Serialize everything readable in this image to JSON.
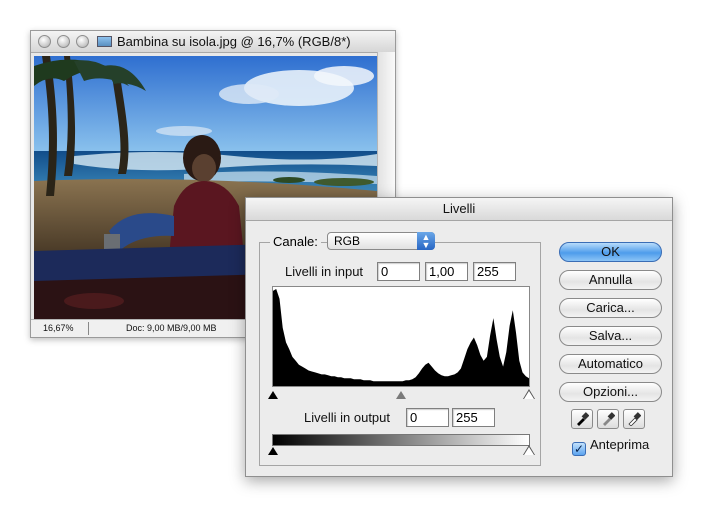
{
  "document_window": {
    "title": "Bambina su isola.jpg @ 16,7% (RGB/8*)",
    "zoom": "16,67%",
    "doc_info": "Doc: 9,00 MB/9,00 MB"
  },
  "levels_dialog": {
    "title": "Livelli",
    "channel_label": "Canale:",
    "channel_value": "RGB",
    "input_levels_label": "Livelli in input",
    "input_black": "0",
    "input_gamma": "1,00",
    "input_white": "255",
    "output_levels_label": "Livelli in output",
    "output_black": "0",
    "output_white": "255",
    "buttons": {
      "ok": "OK",
      "cancel": "Annulla",
      "load": "Carica...",
      "save": "Salva...",
      "auto": "Automatico",
      "options": "Opzioni..."
    },
    "preview_label": "Anteprima",
    "preview_checked": true,
    "histogram": [
      98,
      100,
      90,
      60,
      45,
      38,
      30,
      26,
      22,
      20,
      18,
      16,
      15,
      14,
      13,
      12,
      12,
      11,
      10,
      10,
      9,
      9,
      8,
      8,
      8,
      7,
      7,
      7,
      6,
      6,
      6,
      5,
      5,
      5,
      5,
      5,
      5,
      5,
      5,
      5,
      5,
      6,
      6,
      7,
      9,
      13,
      18,
      22,
      24,
      20,
      16,
      13,
      11,
      10,
      10,
      11,
      12,
      14,
      18,
      28,
      38,
      45,
      50,
      42,
      32,
      26,
      30,
      52,
      70,
      48,
      30,
      20,
      35,
      62,
      78,
      55,
      26,
      14,
      10,
      8
    ],
    "colors": {
      "accent": "#4e9ceb",
      "histogram_fill": "#000000"
    }
  }
}
